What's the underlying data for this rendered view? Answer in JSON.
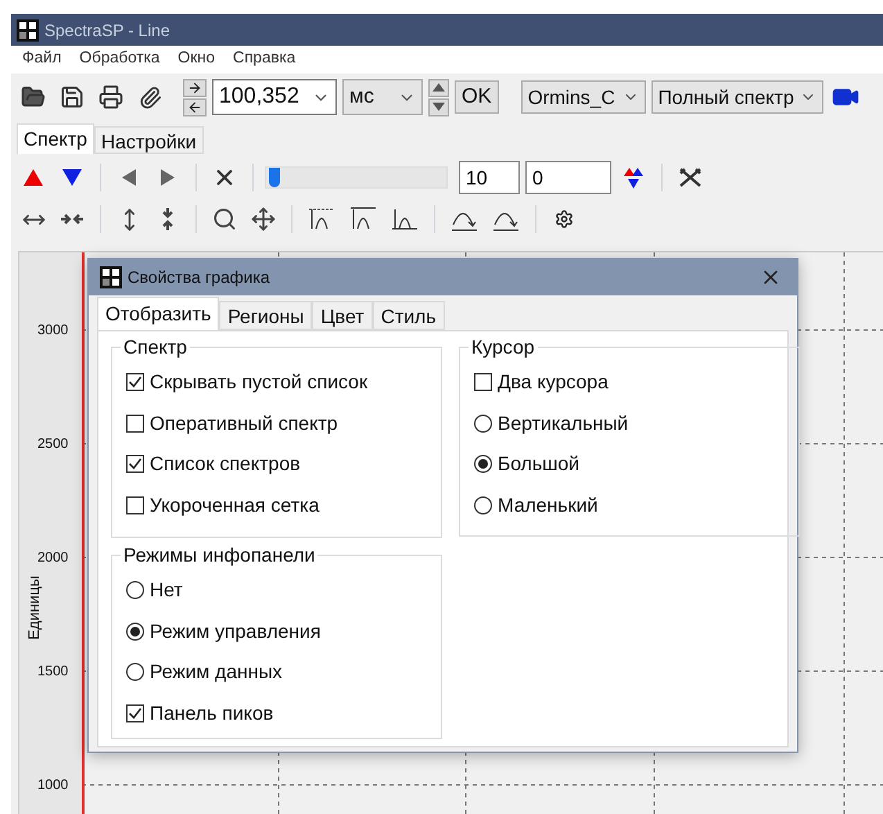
{
  "window": {
    "title": "SpectraSP - Line"
  },
  "menu": [
    "Файл",
    "Обработка",
    "Окно",
    "Справка"
  ],
  "toolbar": {
    "value": "100,352",
    "unit": "мс",
    "ok": "OK",
    "source": "Ormins_C",
    "mode": "Полный спектр"
  },
  "tabs": [
    {
      "label": "Спектр",
      "selected": true
    },
    {
      "label": "Настройки",
      "selected": false
    }
  ],
  "controls": {
    "slider": {
      "level": 0.02
    },
    "field_1": "10",
    "field_2": "0"
  },
  "plot": {
    "axis_title": "Единицы",
    "axis_ticks": [
      "3000",
      "2500",
      "2000",
      "1500",
      "1000"
    ]
  },
  "dialog": {
    "title": "Свойства графика",
    "tabs": [
      {
        "label": "Отобразить",
        "selected": true
      },
      {
        "label": "Регионы",
        "selected": false
      },
      {
        "label": "Цвет",
        "selected": false
      },
      {
        "label": "Стиль",
        "selected": false
      }
    ],
    "groups": [
      {
        "title": "Спектр",
        "items": [
          {
            "kind": "checkbox",
            "label": "Скрывать пустой список",
            "checked": true
          },
          {
            "kind": "checkbox",
            "label": "Оперативный спектр",
            "checked": false
          },
          {
            "kind": "checkbox",
            "label": "Список спектров",
            "checked": true
          },
          {
            "kind": "checkbox",
            "label": "Укороченная сетка",
            "checked": false
          }
        ]
      },
      {
        "title": "Курсор",
        "items": [
          {
            "kind": "checkbox",
            "label": "Два курсора",
            "checked": false
          },
          {
            "kind": "radio",
            "label": "Вертикальный",
            "selected": false
          },
          {
            "kind": "radio",
            "label": "Большой",
            "selected": true
          },
          {
            "kind": "radio",
            "label": "Маленький",
            "selected": false
          }
        ]
      },
      {
        "title": "Режимы инфопанели",
        "items": [
          {
            "kind": "radio",
            "label": "Нет",
            "selected": false
          },
          {
            "kind": "radio",
            "label": "Режим управления",
            "selected": true
          },
          {
            "kind": "radio",
            "label": "Режим данных",
            "selected": false
          },
          {
            "kind": "checkbox",
            "label": "Панель пиков",
            "checked": true
          }
        ]
      }
    ]
  }
}
